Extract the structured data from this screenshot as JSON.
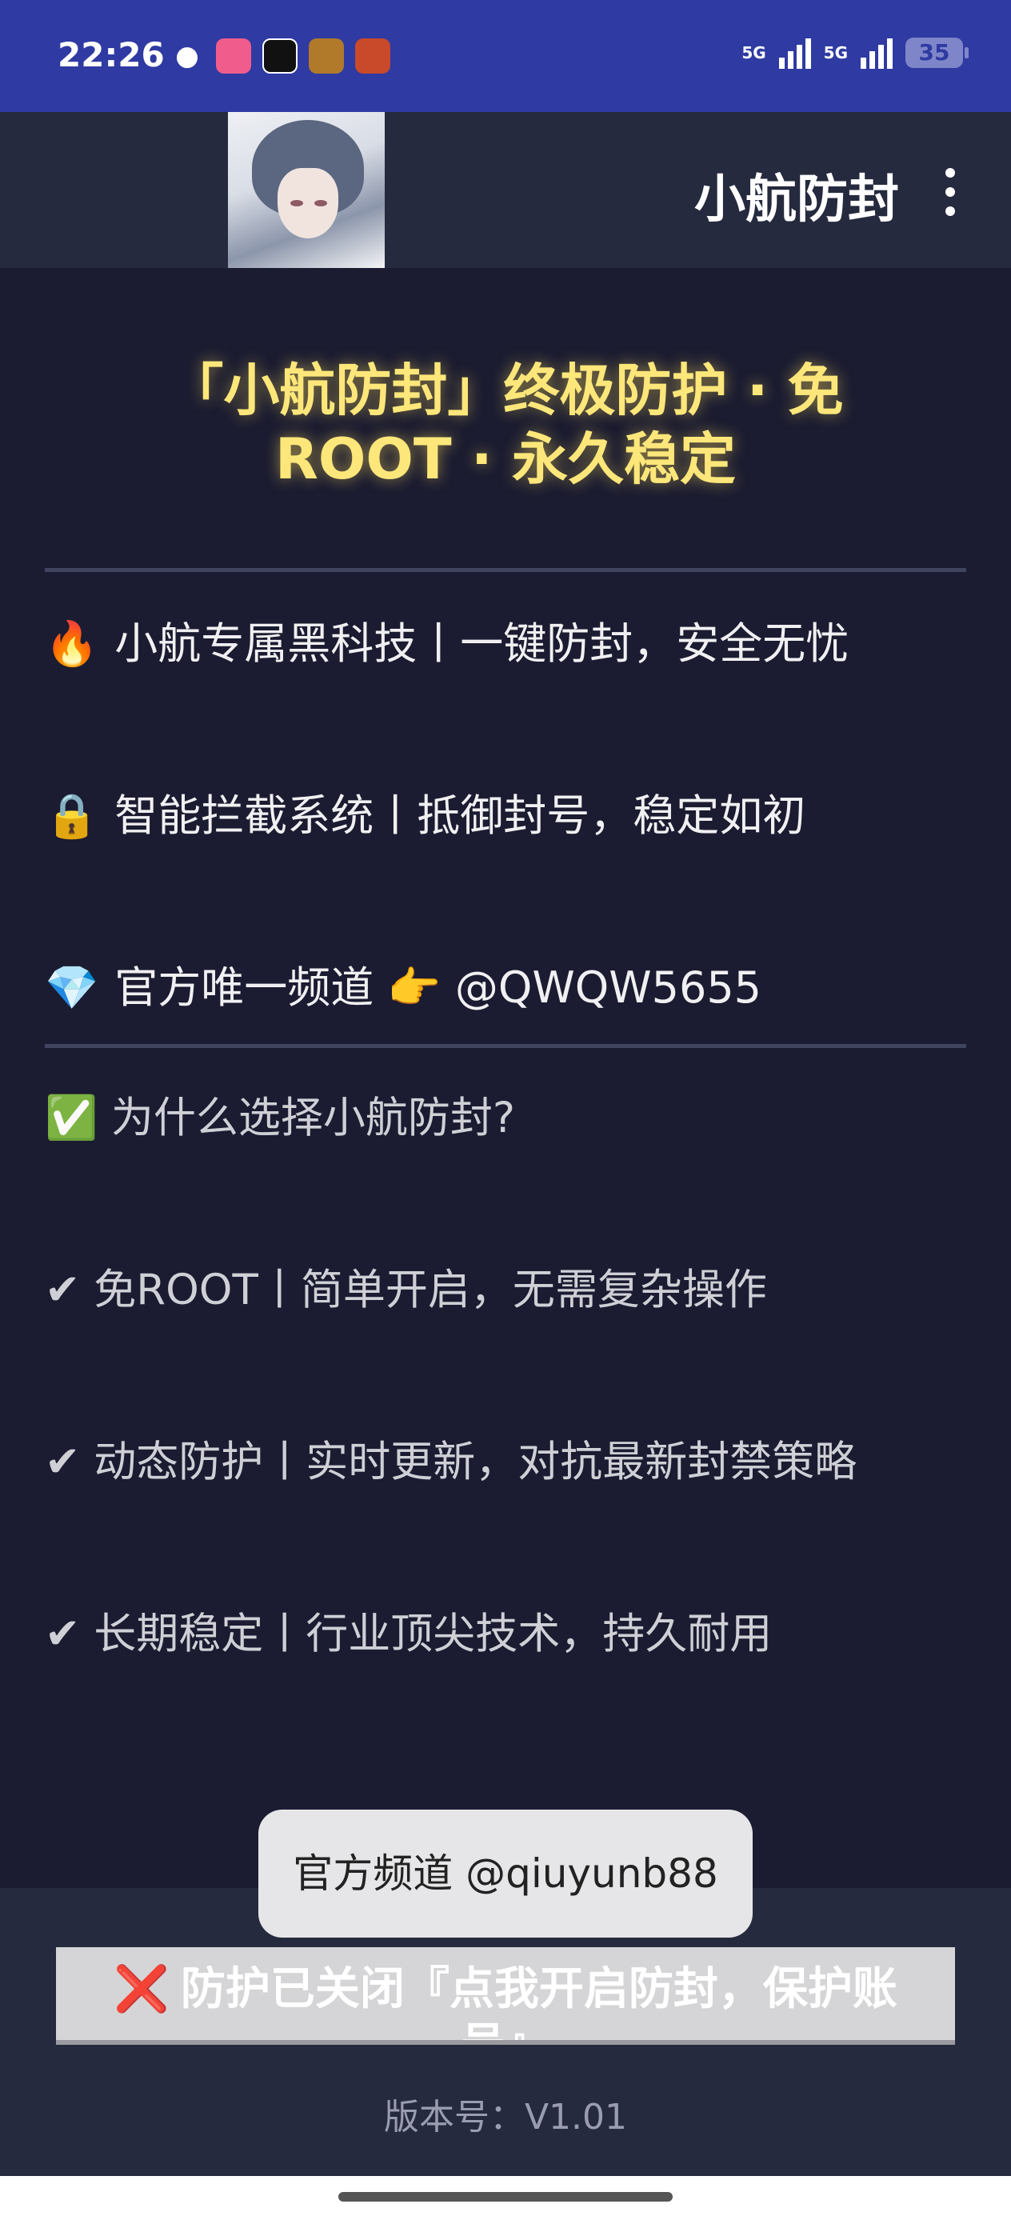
{
  "status_bar": {
    "time": "22:26",
    "network_1": "5G",
    "network_2": "5G",
    "battery": "35",
    "notification_icons": [
      "wechat-icon",
      "bilibili-icon",
      "tiktok-icon",
      "game-icon",
      "game-icon"
    ]
  },
  "app_bar": {
    "title": "小航防封",
    "avatar": "anime-avatar-image",
    "menu_icon": "more-vert-icon"
  },
  "content": {
    "headline": "「小航防封」终极防护 · 免ROOT · 永久稳定",
    "features": [
      {
        "icon": "fire-emoji",
        "emoji": "🔥",
        "text": "小航专属黑科技丨一键防封，安全无忧"
      },
      {
        "icon": "lock-emoji",
        "emoji": "🔒",
        "text": "智能拦截系统丨抵御封号，稳定如初"
      },
      {
        "icon": "gem-emoji",
        "emoji": "💎",
        "text": "官方唯一频道 👉 @QWQW5655"
      }
    ],
    "why_title": "✅ 为什么选择小航防封?",
    "reasons": [
      "✔ 免ROOT丨简单开启，无需复杂操作",
      "✔ 动态防护丨实时更新，对抗最新封禁策略",
      "✔ 长期稳定丨行业顶尖技术，持久耐用"
    ]
  },
  "toast": {
    "text": "官方频道 @qiuyunb88"
  },
  "bottom": {
    "toggle_icon": "❌",
    "toggle_label": "防护已关闭『点我开启防封，保护账号』",
    "version": "版本号：V1.01"
  }
}
